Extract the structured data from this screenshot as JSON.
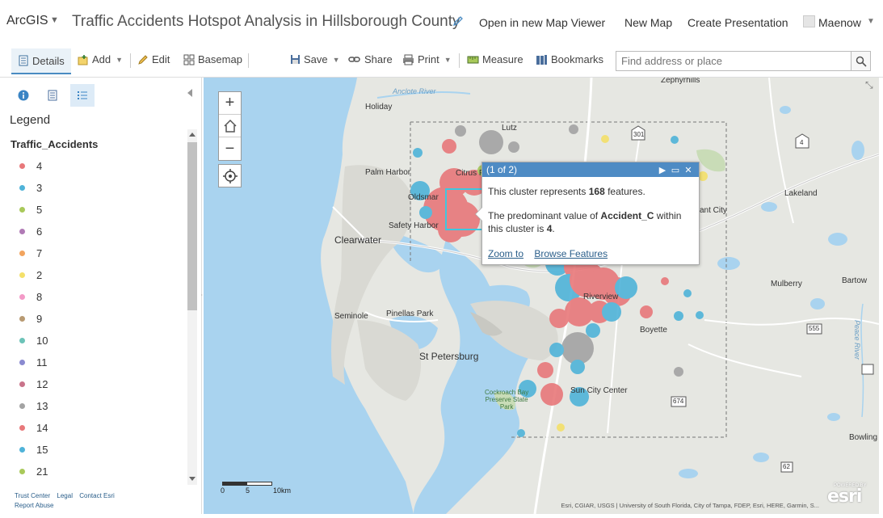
{
  "app": {
    "brand": "ArcGIS",
    "title": "Traffic Accidents Hotspot Analysis in Hillsborough County",
    "links": [
      "Open in new Map Viewer",
      "New Map",
      "Create Presentation"
    ],
    "user": "Maenow"
  },
  "toolbar": {
    "details": "Details",
    "add": "Add",
    "edit": "Edit",
    "basemap": "Basemap",
    "save": "Save",
    "share": "Share",
    "print": "Print",
    "measure": "Measure",
    "bookmarks": "Bookmarks",
    "search_placeholder": "Find address or place"
  },
  "sidebar": {
    "legend_heading": "Legend",
    "layer_name": "Traffic_Accidents",
    "legend_items": [
      {
        "label": "4",
        "color": "#e8787a"
      },
      {
        "label": "3",
        "color": "#4fb3d9"
      },
      {
        "label": "5",
        "color": "#a9c95a"
      },
      {
        "label": "6",
        "color": "#b07ab5"
      },
      {
        "label": "7",
        "color": "#f2a45e"
      },
      {
        "label": "2",
        "color": "#f4e06a"
      },
      {
        "label": "8",
        "color": "#f39ac7"
      },
      {
        "label": "9",
        "color": "#b89a72"
      },
      {
        "label": "10",
        "color": "#6cc3b8"
      },
      {
        "label": "11",
        "color": "#8a8ad0"
      },
      {
        "label": "12",
        "color": "#c9738a"
      },
      {
        "label": "13",
        "color": "#a3a3a3"
      },
      {
        "label": "14",
        "color": "#e8787a"
      },
      {
        "label": "15",
        "color": "#4fb3d9"
      },
      {
        "label": "21",
        "color": "#a9c95a"
      }
    ],
    "footer_links": [
      "Trust Center",
      "Legal",
      "Contact Esri",
      "Report Abuse"
    ]
  },
  "map": {
    "labels": {
      "zephyrhills": "Zephyrhills",
      "holiday": "Holiday",
      "lutz": "Lutz",
      "palm_harbor": "Palm Harbor",
      "citrus_park": "Citrus P",
      "oldsmar": "Oldsmar",
      "safety_harbor": "Safety Harbor",
      "clearwater": "Clearwater",
      "seminole": "Seminole",
      "pinellas_park": "Pinellas Park",
      "st_petersburg": "St Petersburg",
      "riverview": "Riverview",
      "brandon_partial": "ant City",
      "lakeland": "Lakeland",
      "mulberry": "Mulberry",
      "bartow": "Bartow",
      "boyette": "Boyette",
      "sun_city_center": "Sun City Center",
      "bowling": "Bowling",
      "cockroach_bay": "Cockroach Bay\nPreserve State\nPark",
      "anclote_river": "Anclote River",
      "peace_river": "Peace River",
      "route_301": "301",
      "route_4": "4",
      "route_555": "555",
      "route_674": "674",
      "route_62": "62"
    },
    "scale": [
      "0",
      "5",
      "10km"
    ],
    "attribution": "Esri, CGIAR, USGS | University of South Florida, City of Tampa, FDEP, Esri, HERE, Garmin, S...",
    "esri_logo": "esri",
    "esri_powered": "POWERED BY"
  },
  "popup": {
    "pager": "(1 of 2)",
    "line1_prefix": "This cluster represents ",
    "line1_count": "168",
    "line1_suffix": " features.",
    "line2_prefix": "The predominant value of ",
    "line2_field": "Accident_C",
    "line2_mid": " within this cluster is ",
    "line2_value": "4",
    "line2_end": ".",
    "zoom_to": "Zoom to",
    "browse": "Browse Features"
  },
  "colors": {
    "accent": "#4e8bc4",
    "water": "#a9d3ef",
    "land": "#e6e7e2",
    "cluster_red": "#e8787a",
    "cluster_blue": "#4fb3d9",
    "cluster_gray": "#a3a3a3",
    "cluster_yellow": "#f4e06a"
  }
}
